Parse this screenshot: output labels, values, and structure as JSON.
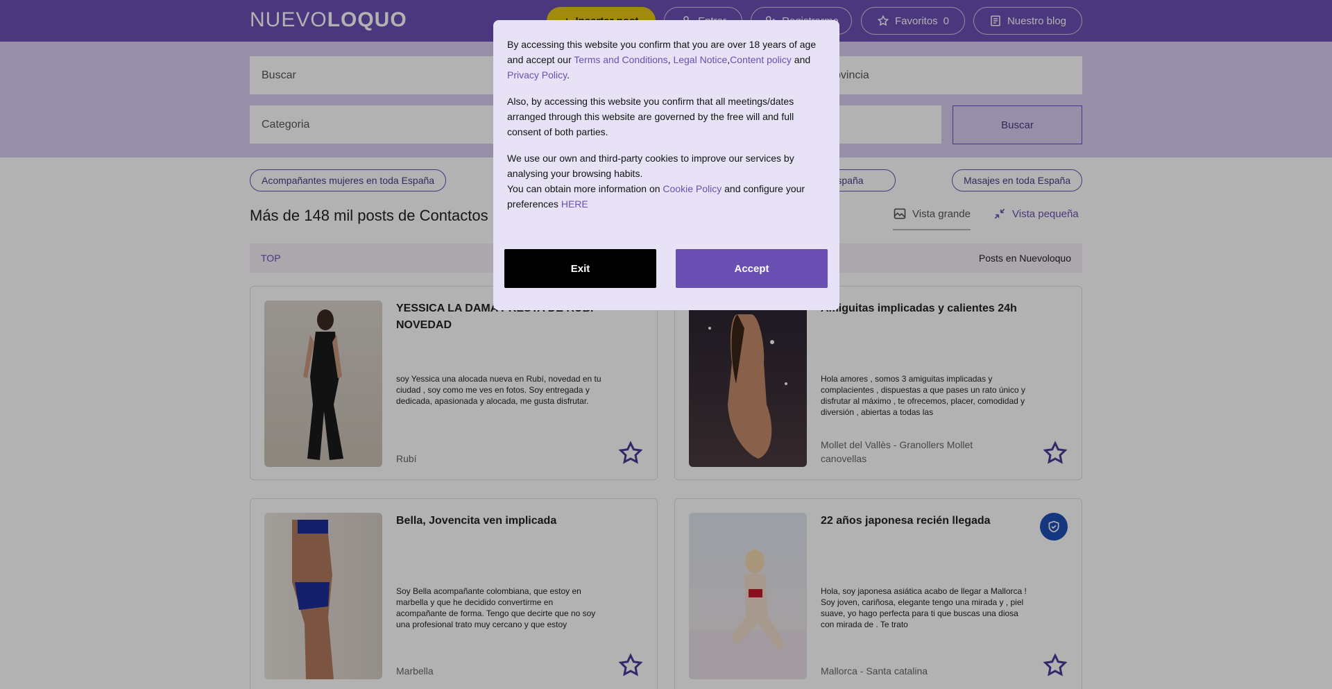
{
  "header": {
    "logo_part1": "NUEVO",
    "logo_part2": "LOQUO",
    "publish_label": "Insertar post",
    "login_label": "Entrar",
    "register_label": "Registrarme",
    "favorites_label": "Favoritos",
    "favorites_count": "0",
    "blog_label": "Nuestro blog"
  },
  "search": {
    "query_placeholder": "Buscar",
    "province_placeholder": "Provincia",
    "category_placeholder": "Categoria",
    "search_button": "Buscar"
  },
  "chips": {
    "women": "Acompañantes mujeres en toda España",
    "middle": "en toda España",
    "massages": "Masajes en toda España"
  },
  "listing": {
    "heading": "Más de 148 mil posts de Contactos",
    "view_large": "Vista grande",
    "view_small": "Vista pequeña",
    "tab_top": "TOP",
    "tab_posts": "Posts en Nuevoloquo"
  },
  "cards": [
    {
      "title": "YESSICA LA DAMA PRESTA DE RUBÍ NOVEDAD",
      "description": "soy Yessica una alocada nueva en Rubí, novedad en tu ciudad , soy como me ves en fotos. Soy entregada y dedicada, apasionada y alocada, me gusta disfrutar.",
      "location": "Rubí"
    },
    {
      "title": "Amiguitas implicadas y calientes 24h",
      "description": "Hola amores , somos 3 amiguitas implicadas y complacientes , dispuestas a que pases un rato único y disfrutar al máximo , te ofrecemos, placer, comodidad y diversión , abiertas a todas las",
      "location": "Mollet del Vallès - Granollers Mollet canovellas"
    },
    {
      "title": "Bella, Jovencita ven implicada",
      "description": "Soy Bella acompañante colombiana, que estoy en marbella y que he decidido convertirme en acompañante de forma. Tengo que decirte que no soy una profesional trato muy cercano y que estoy",
      "location": "Marbella"
    },
    {
      "title": "22 años japonesa recién llegada",
      "description": "Hola, soy japonesa asiática acabo de llegar a Mallorca ! Soy joven, cariñosa, elegante tengo una mirada y , piel suave, yo hago perfecta para ti que buscas una diosa con mirada de . Te trato",
      "location": "Mallorca - Santa catalina"
    }
  ],
  "modal": {
    "p1_a": "By accessing this website you confirm that you are over 18 years of age and accept our ",
    "terms": "Terms and Conditions",
    "comma": ", ",
    "legal": "Legal Notice",
    "comma2": ",",
    "content": "Content policy",
    "and": " and ",
    "privacy": "Privacy Policy",
    "dot": ".",
    "p2": "Also, by accessing this website you confirm that all meetings/dates arranged through this website are governed by the free will and full consent of both parties.",
    "p3_a": "We use our own and third-party cookies to improve our services by analysing your browsing habits.",
    "p3_b": "You can obtain more information on ",
    "cookie": "Cookie Policy",
    "p3_c": " and configure your preferences ",
    "here": "HERE",
    "exit_label": "Exit",
    "accept_label": "Accept"
  },
  "colors": {
    "brand": "#6a4fb3",
    "publish": "#e7c617",
    "verified": "#1f4fb8"
  }
}
